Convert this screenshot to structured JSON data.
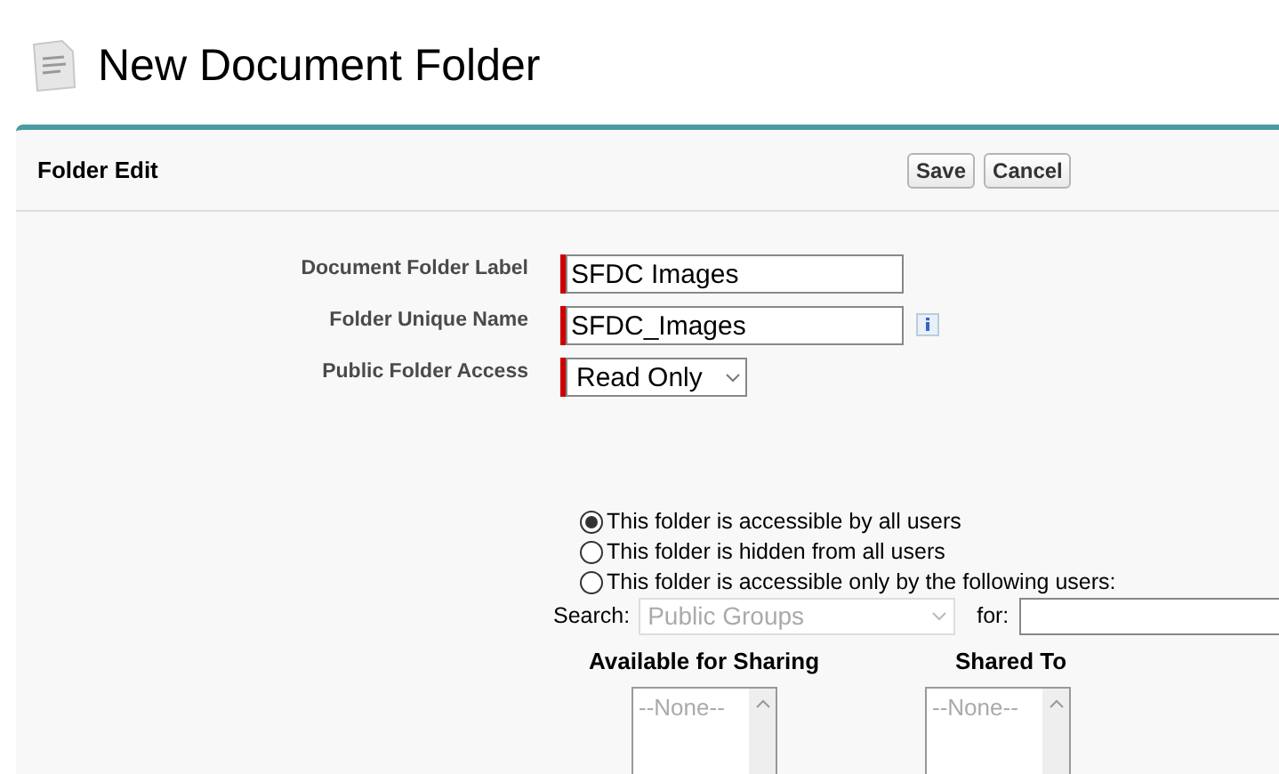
{
  "page_title": "New Document Folder",
  "panel": {
    "title": "Folder Edit",
    "buttons": [
      "Save",
      "Cancel"
    ]
  },
  "fields": [
    {
      "kind": "text",
      "label": "Document Folder Label",
      "value": "SFDC Images",
      "required": true
    },
    {
      "kind": "text",
      "label": "Folder Unique Name",
      "value": "SFDC_Images",
      "required": true,
      "info": true
    },
    {
      "kind": "select",
      "label": "Public Folder Access",
      "value": "Read Only",
      "required": true
    }
  ],
  "access_options": [
    {
      "label": "This folder is accessible by all users",
      "selected": true
    },
    {
      "label": "This folder is hidden from all users",
      "selected": false
    },
    {
      "label": "This folder is accessible only by the following users:",
      "selected": false
    }
  ],
  "search": {
    "label": "Search:",
    "value": "Public Groups",
    "disabled": true,
    "for_label": "for:"
  },
  "lists": [
    {
      "title": "Available for Sharing",
      "empty": "--None--"
    },
    {
      "title": "Shared To",
      "empty": "--None--"
    }
  ]
}
